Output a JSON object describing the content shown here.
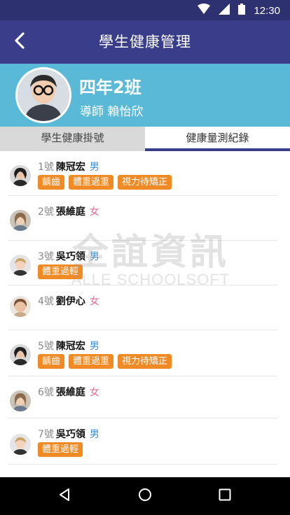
{
  "status_bar": {
    "time": "12:30"
  },
  "app_bar": {
    "title": "學生健康管理",
    "back_icon": "back-arrow-icon"
  },
  "class_info": {
    "name": "四年2班",
    "teacher": "導師 賴怡欣"
  },
  "tabs": [
    {
      "label": "學生健康掛號",
      "active": false
    },
    {
      "label": "健康量測紀錄",
      "active": true
    }
  ],
  "students": [
    {
      "seat": "1號",
      "name": "陳冠宏",
      "gender": "男",
      "tags": [
        "齲齒",
        "體重過重",
        "視力待矯正"
      ]
    },
    {
      "seat": "2號",
      "name": "張維庭",
      "gender": "女",
      "tags": []
    },
    {
      "seat": "3號",
      "name": "吳巧領",
      "gender": "男",
      "tags": [
        "體重過輕"
      ]
    },
    {
      "seat": "4號",
      "name": "劉伊心",
      "gender": "女",
      "tags": []
    },
    {
      "seat": "5號",
      "name": "陳冠宏",
      "gender": "男",
      "tags": [
        "齲齒",
        "體重過重",
        "視力待矯正"
      ]
    },
    {
      "seat": "6號",
      "name": "張維庭",
      "gender": "女",
      "tags": []
    },
    {
      "seat": "7號",
      "name": "吳巧領",
      "gender": "男",
      "tags": [
        "體重過輕"
      ]
    }
  ],
  "watermark": {
    "cn": "全誼資訊",
    "en": "ALLE SCHOOLSOFT"
  },
  "colors": {
    "primary": "#3a3e8a",
    "header": "#5ab9d6",
    "tag": "#f08a24",
    "male": "#3a8fd6",
    "female": "#e06b95"
  }
}
